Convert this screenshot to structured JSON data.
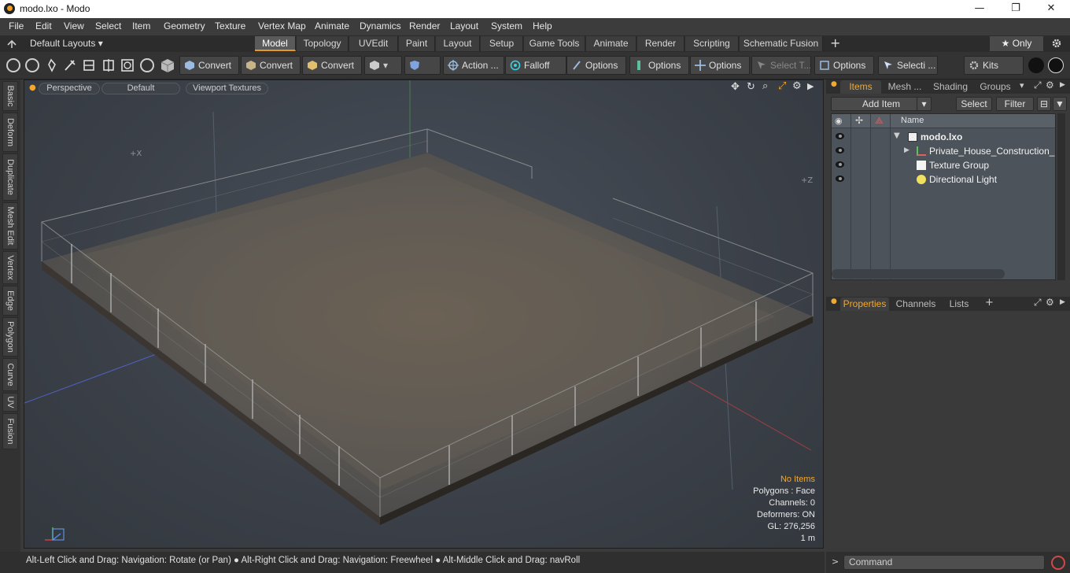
{
  "window": {
    "title": "modo.lxo - Modo",
    "minimize": "—",
    "maximize": "❐",
    "close": "✕"
  },
  "menu": [
    "File",
    "Edit",
    "View",
    "Select",
    "Item",
    "Geometry",
    "Texture",
    "Vertex Map",
    "Animate",
    "Dynamics",
    "Render",
    "Layout",
    "System",
    "Help"
  ],
  "layouts": {
    "label": "Default Layouts ▾"
  },
  "tabs": [
    "Model",
    "Topology",
    "UVEdit",
    "Paint",
    "Layout",
    "Setup",
    "Game Tools",
    "Animate",
    "Render",
    "Scripting",
    "Schematic Fusion"
  ],
  "tab_add": "+",
  "only": "★  Only",
  "toolbar": {
    "convert1": "Convert",
    "convert2": "Convert",
    "convert3": "Convert",
    "action": "Action  ...",
    "falloff": "Falloff",
    "options1": "Options",
    "options2": "Options",
    "options3": "Options",
    "select_t": "Select T...",
    "options4": "Options",
    "selecti": "Selecti ...",
    "kits": "Kits"
  },
  "left_tabs": [
    "Basic",
    "Deform",
    "Duplicate",
    "Mesh Edit",
    "Vertex",
    "Edge",
    "Polygon",
    "Curve",
    "UV",
    "Fusion"
  ],
  "viewport": {
    "perspective": "Perspective",
    "default": "Default",
    "textures": "Viewport Textures",
    "axis_x": "+X",
    "axis_z": "+Z",
    "info": {
      "no_items": "No Items",
      "polygons": "Polygons : Face",
      "channels": "Channels: 0",
      "deformers": "Deformers: ON",
      "gl": "GL: 276,256",
      "unit": "1 m"
    }
  },
  "status": "Alt-Left Click and Drag: Navigation: Rotate (or Pan) ● Alt-Right Click and Drag: Navigation: Freewheel ● Alt-Middle Click and Drag: navRoll",
  "items_panel": {
    "tabs": [
      "Items",
      "Mesh ...",
      "Shading",
      "Groups"
    ],
    "add_item": "Add Item",
    "select": "Select",
    "filter": "Filter",
    "col_name": "Name",
    "rows": [
      {
        "label": "modo.lxo",
        "icon": "scene-icon"
      },
      {
        "label": "Private_House_Construction_...",
        "icon": "locator-icon"
      },
      {
        "label": "Texture Group",
        "icon": "texture-group-icon"
      },
      {
        "label": "Directional Light",
        "icon": "light-icon"
      }
    ]
  },
  "props_panel": {
    "tabs": [
      "Properties",
      "Channels",
      "Lists"
    ],
    "add": "+"
  },
  "command": {
    "placeholder": "Command"
  },
  "colors": {
    "accent": "#f0a830",
    "active_tab": "#e69a1c"
  }
}
